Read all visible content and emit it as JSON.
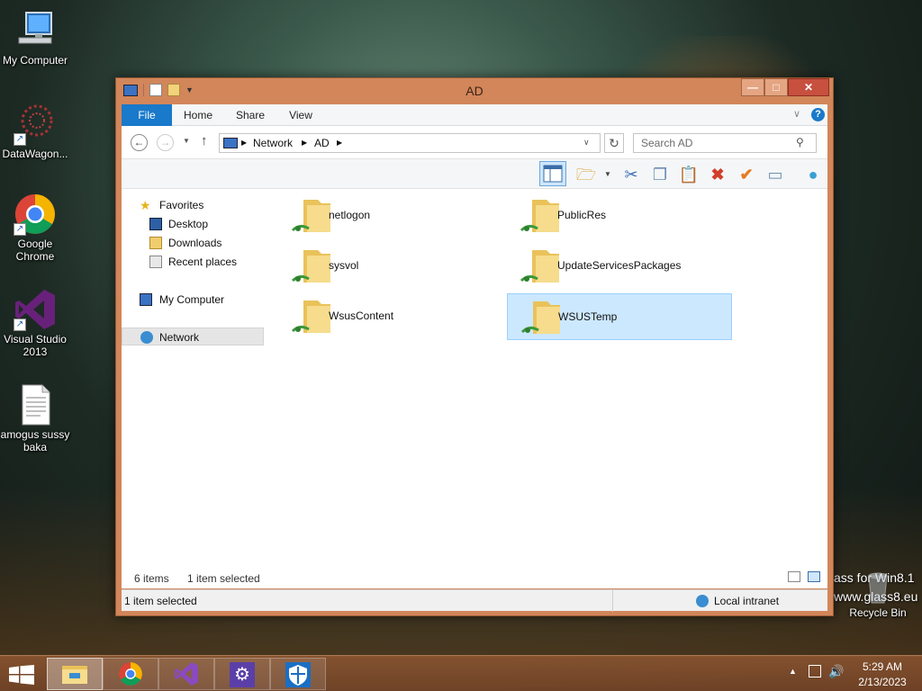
{
  "desktop": {
    "icons": [
      {
        "label": "My Computer"
      },
      {
        "label": "DataWagon..."
      },
      {
        "label": "Google Chrome"
      },
      {
        "label": "Visual Studio 2013"
      },
      {
        "label": "amogus sussy baka"
      }
    ],
    "recycle_bin": "Recycle Bin",
    "watermark_line1": "ass for Win8.1",
    "watermark_line2": "www.glass8.eu"
  },
  "window": {
    "title": "AD",
    "controls": {
      "minimize": "—",
      "maximize": "□",
      "close": "✕"
    },
    "ribbon_tabs": [
      {
        "label": "File"
      },
      {
        "label": "Home"
      },
      {
        "label": "Share"
      },
      {
        "label": "View"
      }
    ],
    "address": {
      "crumbs": [
        "Network",
        "AD"
      ],
      "search_placeholder": "Search AD"
    },
    "nav_pane": {
      "favorites": "Favorites",
      "desktop": "Desktop",
      "downloads": "Downloads",
      "recent_places": "Recent places",
      "my_computer": "My Computer",
      "network": "Network"
    },
    "folders": [
      {
        "name": "netlogon",
        "selected": false
      },
      {
        "name": "PublicRes",
        "selected": false
      },
      {
        "name": "sysvol",
        "selected": false
      },
      {
        "name": "UpdateServicesPackages",
        "selected": false
      },
      {
        "name": "WsusContent",
        "selected": false
      },
      {
        "name": "WSUSTemp",
        "selected": true
      }
    ],
    "status": {
      "item_count": "6 items",
      "selection": "1 item selected",
      "bottom_left": "1 item selected",
      "zone": "Local intranet"
    }
  },
  "taskbar": {
    "time": "5:29 AM",
    "date": "2/13/2023"
  },
  "colors": {
    "window_frame": "#d2865a",
    "file_tab": "#1979ca",
    "selection": "#cce8ff",
    "close_button": "#c7503f"
  }
}
